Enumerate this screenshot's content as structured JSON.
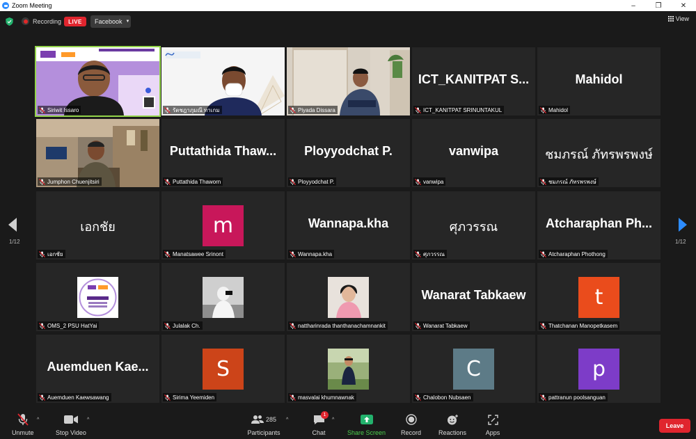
{
  "window": {
    "title": "Zoom Meeting"
  },
  "topbar": {
    "recording_label": "Recording",
    "live_label": "LIVE",
    "stream_target": "Facebook",
    "view_label": "View"
  },
  "pagination": {
    "left": "1/12",
    "right": "1/12"
  },
  "tiles": [
    {
      "label": "Siriwit Issaro",
      "big": ""
    },
    {
      "label": "รัตชฎาภุมณี ทาเกม",
      "big": ""
    },
    {
      "label": "Piyada Dissara",
      "big": ""
    },
    {
      "label": "ICT_KANITPAT SRINUNTAKUL",
      "big": "ICT_KANITPAT  S..."
    },
    {
      "label": "Mahidol",
      "big": "Mahidol"
    },
    {
      "label": "Jumphon Chuenjitsiri",
      "big": ""
    },
    {
      "label": "Puttathida Thaworn",
      "big": "Puttathida  Thaw..."
    },
    {
      "label": "Ployyodchat P.",
      "big": "Ployyodchat P."
    },
    {
      "label": "vanwipa",
      "big": "vanwipa"
    },
    {
      "label": "ชมภรณ์ ภัทรพรพงษ์",
      "big": "ชมภรณ์ ภัทรพรพงษ์"
    },
    {
      "label": "เอกชัย",
      "big": "เอกชัย"
    },
    {
      "label": "Manatsawee Srinont",
      "big": "",
      "avatar": "m"
    },
    {
      "label": "Wannapa.kha",
      "big": "Wannapa.kha"
    },
    {
      "label": "ศุภวรรณ",
      "big": "ศุภวรรณ"
    },
    {
      "label": "Atcharaphan Phothong",
      "big": "Atcharaphan  Ph..."
    },
    {
      "label": "OMS_2 PSU HatYai",
      "big": ""
    },
    {
      "label": "Julalak Ch.",
      "big": ""
    },
    {
      "label": "nattharinrada thanthanachamnankit",
      "big": ""
    },
    {
      "label": "Wanarat Tabkaew",
      "big": "Wanarat Tabkaew"
    },
    {
      "label": "Thatchanan Manopetkasem",
      "big": "",
      "avatar": "t"
    },
    {
      "label": "Auemduen Kaewsawang",
      "big": "Auemduen  Kae..."
    },
    {
      "label": "Sirima Yeemiden",
      "big": "",
      "avatar": "S"
    },
    {
      "label": "masvalai khumnawnak",
      "big": ""
    },
    {
      "label": "Chalobon Nubsaen",
      "big": "",
      "avatar": "C"
    },
    {
      "label": "pattranun poolsanguan",
      "big": "",
      "avatar": "p"
    }
  ],
  "avatar_colors": {
    "m": "#c8175a",
    "t": "#ea4c1c",
    "S": "#cc4419",
    "C": "#5d7b87",
    "p": "#7d3cc8"
  },
  "toolbar": {
    "unmute": "Unmute",
    "stop_video": "Stop Video",
    "participants": "Participants",
    "participants_count": "285",
    "chat": "Chat",
    "chat_badge": "1",
    "share_screen": "Share Screen",
    "record": "Record",
    "reactions": "Reactions",
    "apps": "Apps",
    "leave": "Leave"
  }
}
